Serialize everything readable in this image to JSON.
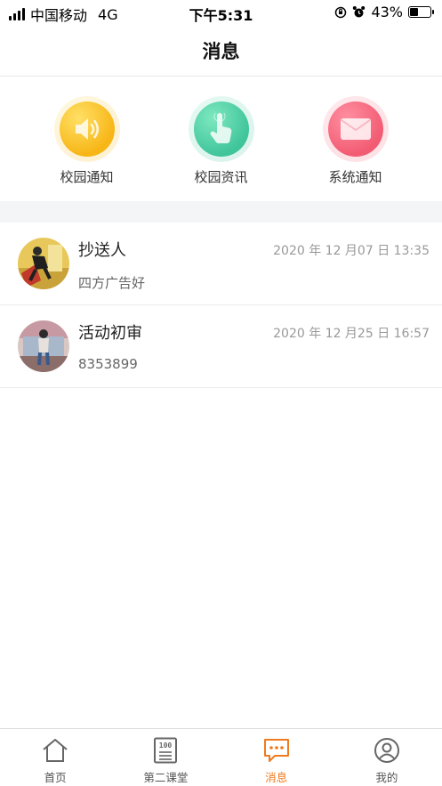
{
  "status_bar": {
    "carrier": "中国移动",
    "network": "4G",
    "time": "下午5:31",
    "battery_percent": "43%",
    "battery_level": 0.43
  },
  "header": {
    "title": "消息"
  },
  "categories": [
    {
      "label": "校园通知",
      "icon": "speaker-icon",
      "color": "#f7b515"
    },
    {
      "label": "校园资讯",
      "icon": "hand-pointer-icon",
      "color": "#3fc49a"
    },
    {
      "label": "系统通知",
      "icon": "envelope-icon",
      "color": "#f25b72"
    }
  ],
  "messages": [
    {
      "title": "抄送人",
      "time": "2020 年 12 月07 日 13:35",
      "preview": "四方广告好"
    },
    {
      "title": "活动初审",
      "time": "2020 年 12 月25 日 16:57",
      "preview": "8353899"
    }
  ],
  "tabs": [
    {
      "label": "首页",
      "icon": "home-icon",
      "active": false
    },
    {
      "label": "第二课堂",
      "icon": "score-board-icon",
      "active": false
    },
    {
      "label": "消息",
      "icon": "chat-bubble-icon",
      "active": true
    },
    {
      "label": "我的",
      "icon": "user-icon",
      "active": false
    }
  ],
  "colors": {
    "accent": "#f07a1e",
    "gray_icon": "#666666"
  }
}
